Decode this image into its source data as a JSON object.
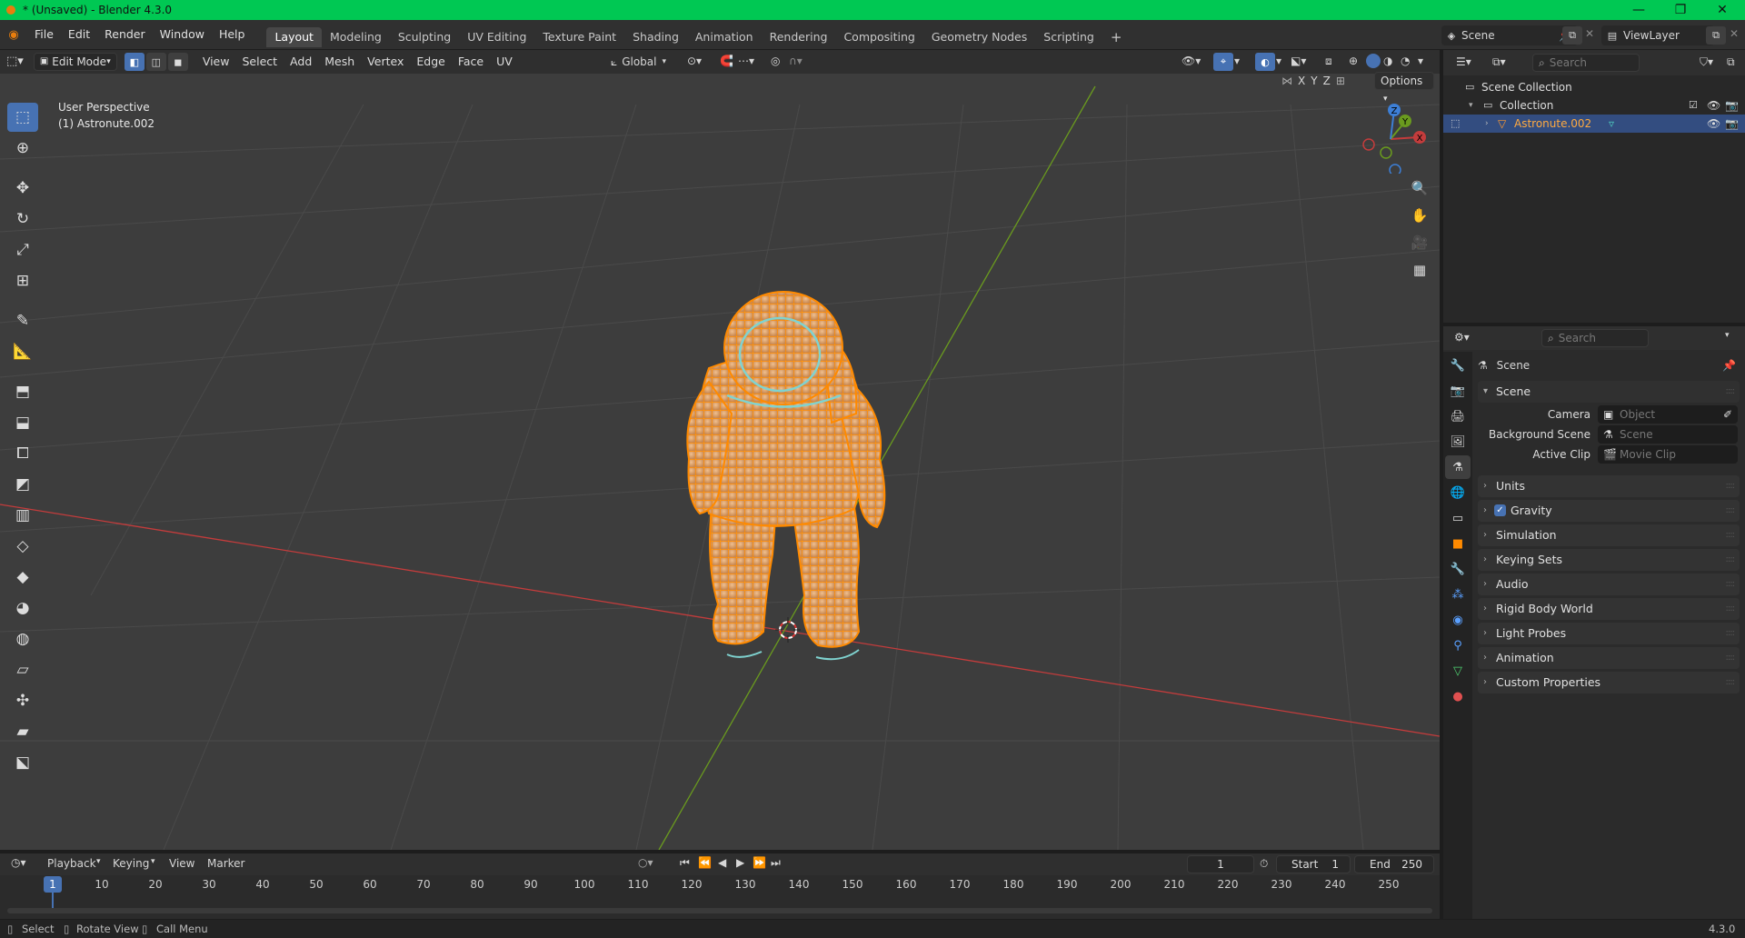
{
  "window": {
    "title": "* (Unsaved) - Blender 4.3.0",
    "minimize": "—",
    "maximize": "❐",
    "close": "✕"
  },
  "menu": [
    "File",
    "Edit",
    "Render",
    "Window",
    "Help"
  ],
  "workspaces": [
    "Layout",
    "Modeling",
    "Sculpting",
    "UV Editing",
    "Texture Paint",
    "Shading",
    "Animation",
    "Rendering",
    "Compositing",
    "Geometry Nodes",
    "Scripting"
  ],
  "workspace_add": "+",
  "scene_field": "Scene",
  "viewlayer_field": "ViewLayer",
  "viewport": {
    "mode": "Edit Mode",
    "menus": [
      "View",
      "Select",
      "Add",
      "Mesh",
      "Vertex",
      "Edge",
      "Face",
      "UV"
    ],
    "transform_orientation": "Global",
    "options_label": "Options",
    "axes_x": "X",
    "axes_y": "Y",
    "axes_z": "Z",
    "overlay_line1": "User Perspective",
    "overlay_line2": "(1) Astronute.002",
    "gizmo": {
      "x": "X",
      "y": "Y",
      "z": "Z"
    }
  },
  "outliner": {
    "search_placeholder": "Search",
    "root": "Scene Collection",
    "collection": "Collection",
    "object": "Astronute.002"
  },
  "properties": {
    "search_placeholder": "Search",
    "context": "Scene",
    "section": "Scene",
    "rows": [
      {
        "label": "Camera",
        "placeholder": "Object"
      },
      {
        "label": "Background Scene",
        "placeholder": "Scene"
      },
      {
        "label": "Active Clip",
        "placeholder": "Movie Clip"
      }
    ],
    "panels": [
      "Units",
      "Gravity",
      "Simulation",
      "Keying Sets",
      "Audio",
      "Rigid Body World",
      "Light Probes",
      "Animation",
      "Custom Properties"
    ],
    "gravity_checked": true
  },
  "timeline": {
    "menus": [
      "Playback",
      "Keying",
      "View",
      "Marker"
    ],
    "current_frame": "1",
    "start_label": "Start",
    "start_value": "1",
    "end_label": "End",
    "end_value": "250",
    "ticks": [
      "10",
      "20",
      "30",
      "40",
      "50",
      "60",
      "70",
      "80",
      "90",
      "100",
      "110",
      "120",
      "130",
      "140",
      "150",
      "160",
      "170",
      "180",
      "190",
      "200",
      "210",
      "220",
      "230",
      "240",
      "250"
    ]
  },
  "status": {
    "select": "Select",
    "rotate": "Rotate View",
    "call_menu": "Call Menu",
    "version": "4.3.0"
  },
  "colors": {
    "title_bar": "#00c853",
    "accent": "#4772b3",
    "selection": "#ff8a00",
    "x_axis": "#c43c3c",
    "y_axis": "#6a9b1e"
  }
}
